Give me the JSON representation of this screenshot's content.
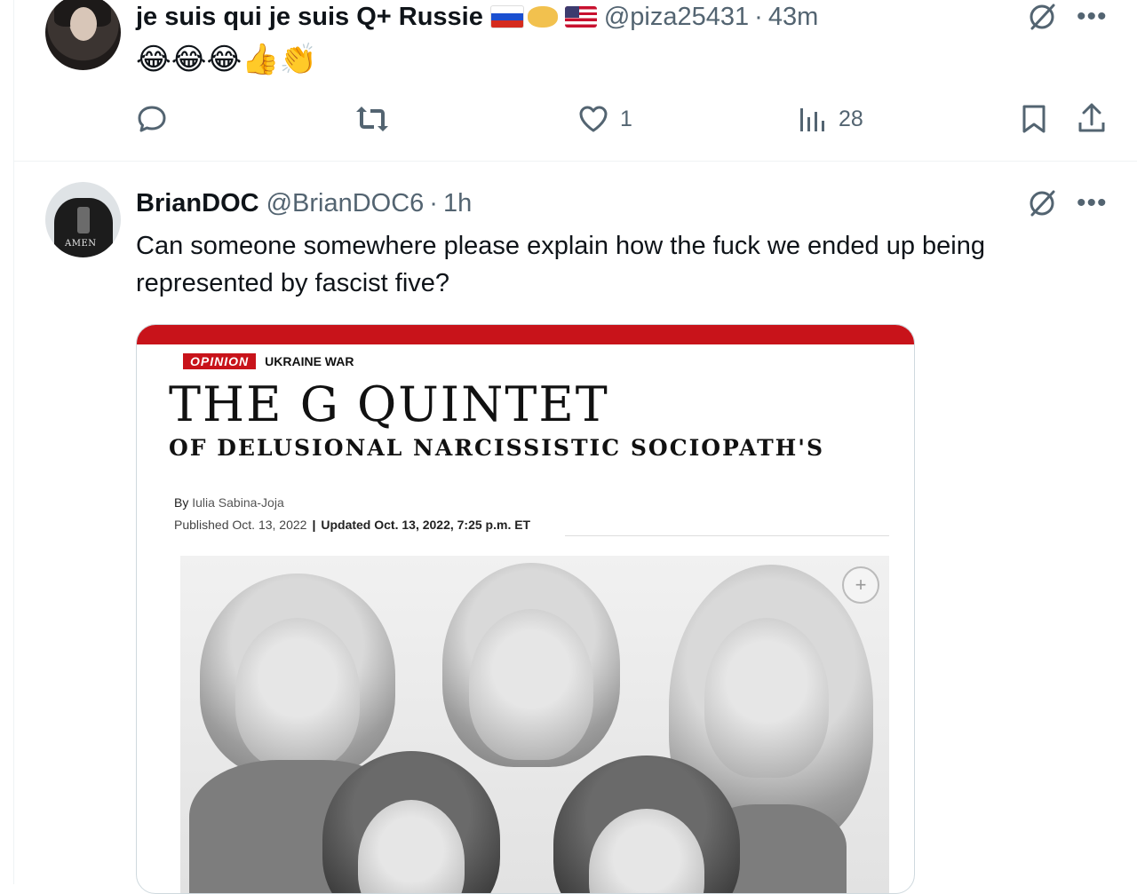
{
  "tweet1": {
    "display_name": "je suis qui je suis Q+ Russie",
    "handle": "@piza25431",
    "separator": "·",
    "time": "43m",
    "body": "😂😂😂👍👏",
    "stats": {
      "likes": "1",
      "views": "28"
    }
  },
  "tweet2": {
    "display_name": "BrianDOC",
    "handle": "@BrianDOC6",
    "separator": "·",
    "time": "1h",
    "body": "Can someone somewhere please explain how the fuck we ended up being represented by fascist five?",
    "avatar_text": "AMEN"
  },
  "media": {
    "tag_opinion": "OPINION",
    "tag_section": "UKRAINE WAR",
    "headline": "THE G QUINTET",
    "subhead": "OF DELUSIONAL NARCISSISTIC SOCIOPATH'S",
    "byline_prefix": "By",
    "author": "Iulia Sabina-Joja",
    "published": "Published Oct. 13, 2022",
    "separator": "|",
    "updated": "Updated Oct. 13, 2022, 7:25 p.m. ET",
    "zoom_symbol": "+"
  },
  "colors": {
    "text_primary": "#0f1419",
    "text_secondary": "#536471",
    "brand_red": "#c8131a",
    "border": "#cfd9de"
  },
  "icons": [
    "grok-icon",
    "more-icon",
    "reply-icon",
    "retweet-icon",
    "like-icon",
    "views-icon",
    "bookmark-icon",
    "share-icon",
    "zoom-icon"
  ]
}
